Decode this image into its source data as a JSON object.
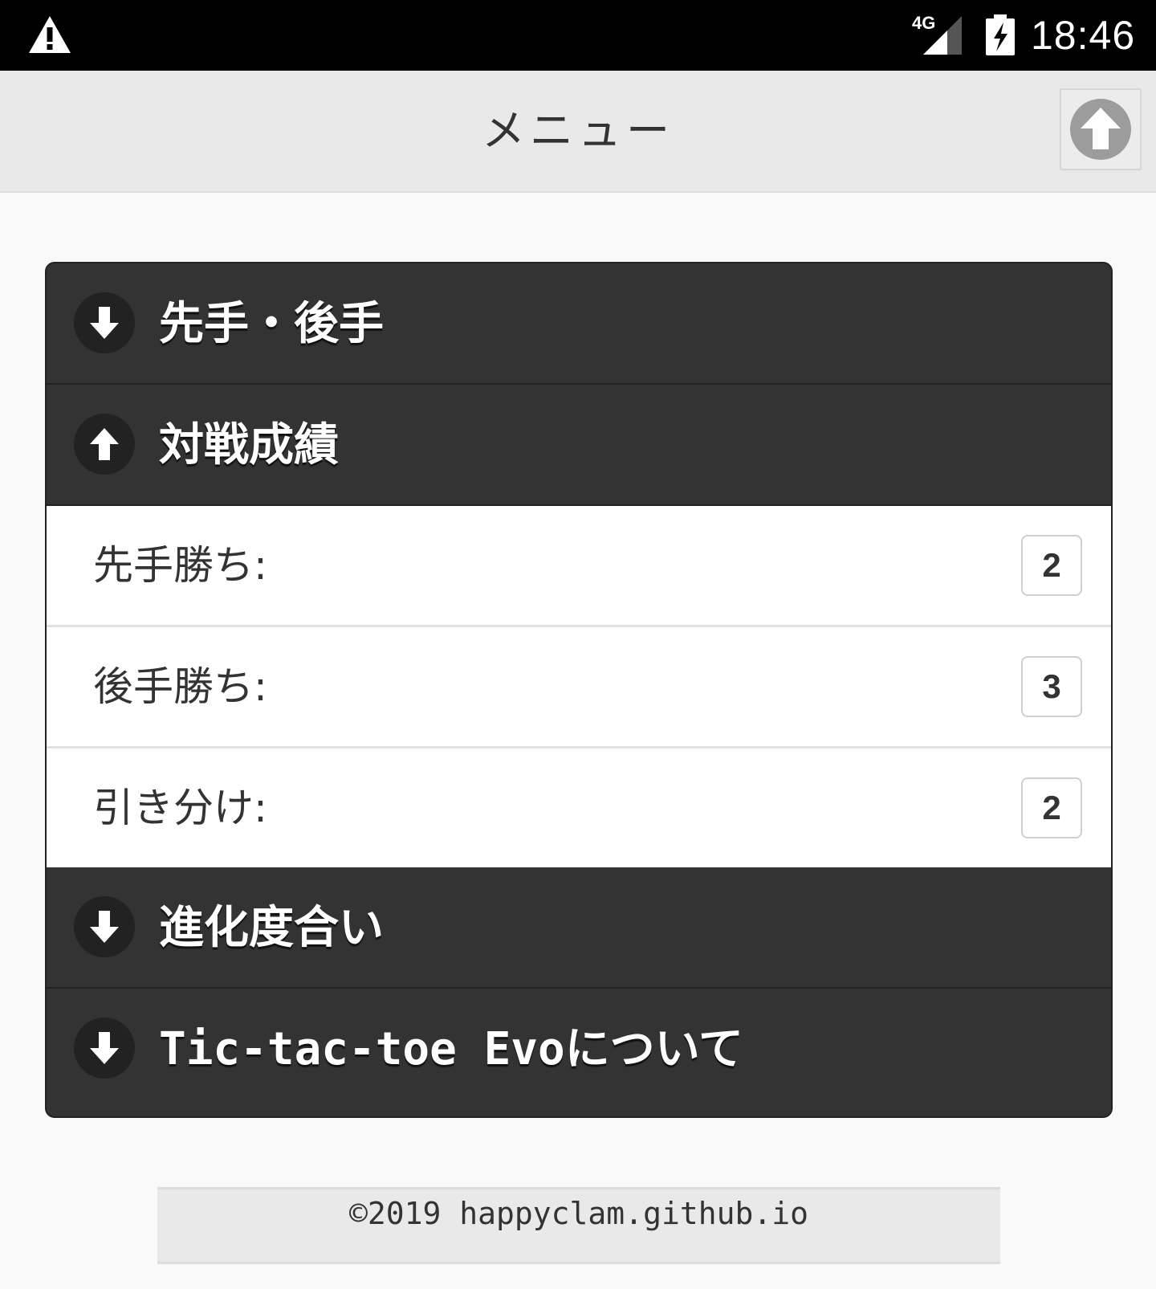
{
  "status_bar": {
    "network": "4G",
    "time": "18:46",
    "icons": [
      "warning-icon",
      "signal-icon",
      "battery-charging-icon"
    ]
  },
  "header": {
    "title": "メニュー",
    "up_icon": "arrow-up-circle-icon"
  },
  "accordion": {
    "sections": [
      {
        "label": "先手・後手",
        "icon": "arrow-down-circle-icon",
        "expanded": false
      },
      {
        "label": "対戦成績",
        "icon": "arrow-up-circle-icon",
        "expanded": true
      },
      {
        "label": "進化度合い",
        "icon": "arrow-down-circle-icon",
        "expanded": false
      },
      {
        "label": "Tic-tac-toe Evoについて",
        "icon": "arrow-down-circle-icon",
        "expanded": false
      }
    ],
    "stats": [
      {
        "label": "先手勝ち:",
        "count": "2"
      },
      {
        "label": "後手勝ち:",
        "count": "3"
      },
      {
        "label": "引き分け:",
        "count": "2"
      }
    ]
  },
  "footer": {
    "text": "©2019 happyclam.github.io"
  },
  "colors": {
    "status_bar_bg": "#000000",
    "header_bg": "#e9e9e9",
    "accordion_header_bg": "#333333",
    "content_bg": "#ffffff",
    "page_bg": "#f9f9f9"
  }
}
